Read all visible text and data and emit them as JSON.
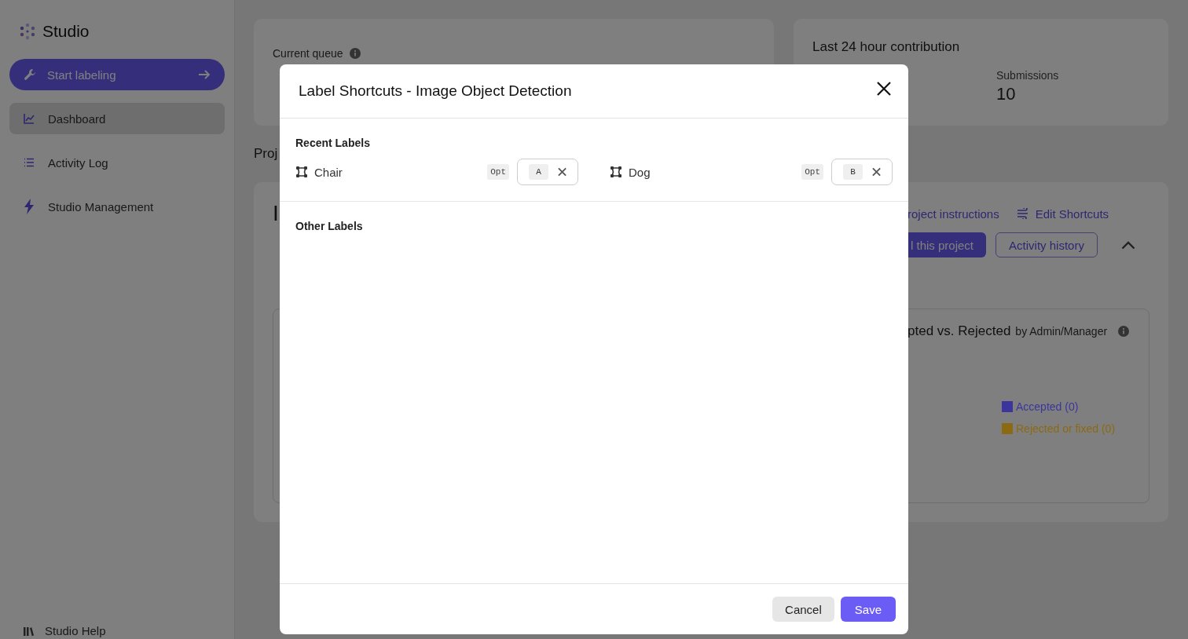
{
  "sidebar": {
    "brand": "Studio",
    "primary_button": "Start labeling",
    "items": [
      {
        "label": "Dashboard",
        "selected": true
      },
      {
        "label": "Activity Log",
        "selected": false
      },
      {
        "label": "Studio Management",
        "selected": false
      }
    ],
    "help": "Studio Help"
  },
  "queue_card": {
    "title": "Current queue"
  },
  "contribution_card": {
    "title": "Last 24 hour contribution",
    "stats": [
      {
        "label": "Submissions",
        "value": "10"
      }
    ]
  },
  "section_title": "Proj",
  "project_card": {
    "title": "I",
    "links": [
      {
        "label": "roject instructions",
        "has_icon": false
      },
      {
        "label": "Edit Shortcuts",
        "has_icon": true
      }
    ],
    "buttons": [
      {
        "label": "l this project",
        "kind": "primary"
      },
      {
        "label": "Activity history",
        "kind": "outline"
      }
    ],
    "chart_card": {
      "title": "pted vs. Rejected",
      "subtitle": "by Admin/Manager",
      "legend": [
        {
          "label": "Accepted (0)",
          "color": "#3c359e"
        },
        {
          "label": "Rejected or fixed (0)",
          "color": "#8c6a12"
        }
      ]
    }
  },
  "modal": {
    "title": "Label Shortcuts - Image Object Detection",
    "sections": [
      {
        "title": "Recent Labels",
        "labels": [
          {
            "name": "Chair",
            "modifier": "Opt",
            "key": "A"
          },
          {
            "name": "Dog",
            "modifier": "Opt",
            "key": "B"
          }
        ]
      },
      {
        "title": "Other Labels"
      }
    ],
    "buttons": [
      {
        "label": "Cancel",
        "kind": "secondary"
      },
      {
        "label": "Save",
        "kind": "primary"
      }
    ]
  }
}
